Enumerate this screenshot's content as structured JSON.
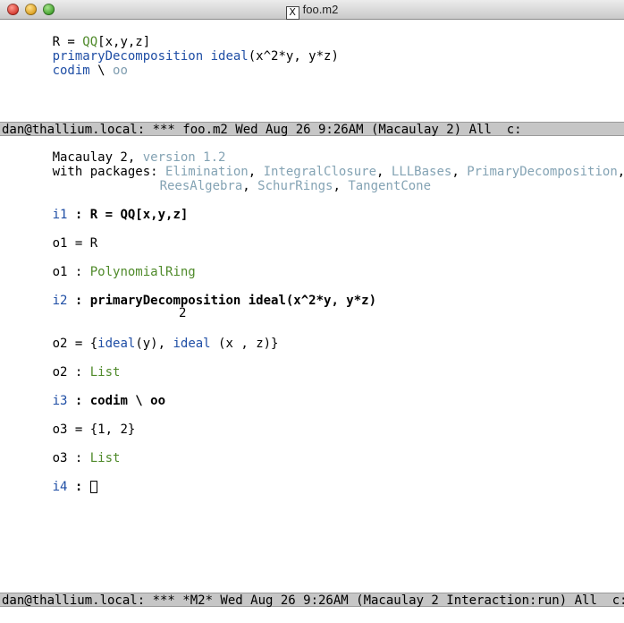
{
  "window": {
    "title": "foo.m2",
    "x_icon": "X"
  },
  "editor": {
    "line1": {
      "a": "R = ",
      "b": "QQ",
      "c": "[x,y,z]"
    },
    "line2": {
      "a": "primaryDecomposition",
      "b": " ",
      "c": "ideal",
      "d": "(x^2*y, y*z)"
    },
    "line3": {
      "a": "codim",
      "b": " \\ ",
      "c": "oo"
    }
  },
  "modeline_top": "dan@thallium.local: *** foo.m2 Wed Aug 26 9:26AM (Macaulay 2) All  c:",
  "session": {
    "banner1": {
      "a": "Macaulay 2, ",
      "b": "version 1.2"
    },
    "banner2": {
      "prefix": "with packages: ",
      "p1": "Elimination",
      "s1": ", ",
      "p2": "IntegralClosure",
      "s2": ", ",
      "p3": "LLLBases",
      "s3": ", ",
      "p4": "PrimaryDecomposition",
      "s4": ","
    },
    "banner3": {
      "p5": "ReesAlgebra",
      "s5": ", ",
      "p6": "SchurRings",
      "s6": ", ",
      "p7": "TangentCone"
    },
    "i1": {
      "label": "i1",
      "sep": " : ",
      "input": "R = QQ[x,y,z]"
    },
    "o1a": {
      "label": "o1",
      "text": " = R"
    },
    "o1b": {
      "label": "o1",
      "sep": " : ",
      "type": "PolynomialRing"
    },
    "i2": {
      "label": "i2",
      "sep": " : ",
      "input": "primaryDecomposition ideal(x^2*y, y*z)"
    },
    "o2a": {
      "label": "o2",
      "pre": " = {",
      "f1": "ideal",
      "arg1": "(y), ",
      "f2": "ideal",
      "arg2": " (x , z)}",
      "exponent": "2"
    },
    "o2b": {
      "label": "o2",
      "sep": " : ",
      "type": "List"
    },
    "i3": {
      "label": "i3",
      "sep": " : ",
      "input": "codim \\ oo"
    },
    "o3a": {
      "label": "o3",
      "text": " = {1, 2}"
    },
    "o3b": {
      "label": "o3",
      "sep": " : ",
      "type": "List"
    },
    "i4": {
      "label": "i4",
      "sep": " : "
    }
  },
  "modeline_bottom": "dan@thallium.local: *** *M2* Wed Aug 26 9:26AM (Macaulay 2 Interaction:run) All  c:"
}
